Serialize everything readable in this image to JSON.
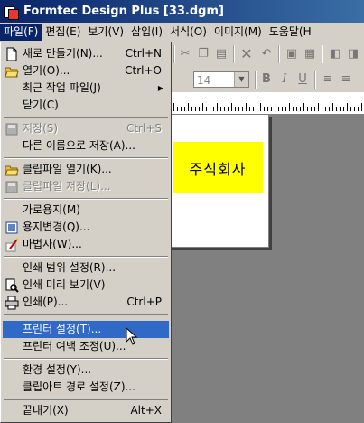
{
  "window": {
    "title": "Formtec Design Plus [33.dgm]"
  },
  "menubar": [
    "파일(F)",
    "편집(E)",
    "보기(V)",
    "삽입(I)",
    "서식(O)",
    "이미지(M)",
    "도움말(H"
  ],
  "toolbar": {
    "font_size": "14"
  },
  "canvas": {
    "company_text": "주식회사"
  },
  "file_menu": {
    "new": {
      "label": "새로 만들기(N)...",
      "shortcut": "Ctrl+N"
    },
    "open": {
      "label": "열기(O)...",
      "shortcut": "Ctrl+O"
    },
    "recent": {
      "label": "최근 작업 파일(J)"
    },
    "close": {
      "label": "닫기(C)"
    },
    "save": {
      "label": "저장(S)",
      "shortcut": "Ctrl+S"
    },
    "save_as": {
      "label": "다른 이름으로 저장(A)..."
    },
    "clip_open": {
      "label": "클립파일 열기(K)..."
    },
    "clip_save": {
      "label": "클립파일 저장(L)..."
    },
    "landscape": {
      "label": "가로용지(M)"
    },
    "paper_change": {
      "label": "용지변경(Q)..."
    },
    "wizard": {
      "label": "마법사(W)..."
    },
    "print_range": {
      "label": "인쇄 범위 설정(R)..."
    },
    "print_preview": {
      "label": "인쇄 미리 보기(V)"
    },
    "print": {
      "label": "인쇄(P)...",
      "shortcut": "Ctrl+P"
    },
    "printer_setup": {
      "label": "프린터 설정(T)..."
    },
    "printer_margin": {
      "label": "프린터 여백 조정(U)..."
    },
    "env_setup": {
      "label": "환경 설정(Y)..."
    },
    "clipart_path": {
      "label": "클립아트 경로 설정(Z)..."
    },
    "exit": {
      "label": "끝내기(X)",
      "shortcut": "Alt+X"
    }
  }
}
